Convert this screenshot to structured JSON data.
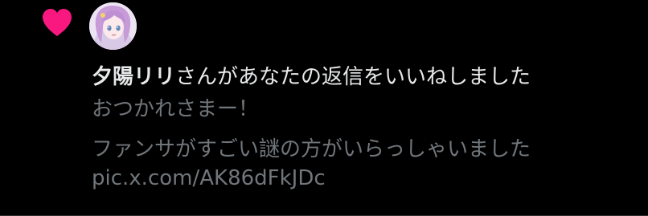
{
  "notification": {
    "icon": "heart-icon",
    "icon_color": "#f91880",
    "avatar": "user-avatar",
    "user_name": "夕陽リリ",
    "action_text": "さんがあなたの返信をいいねしました",
    "reply_text": "おつかれさまー！",
    "body_text": "ファンサがすごい謎の方がいらっしゃいました",
    "link_text": "pic.x.com/AK86dFkJDc"
  },
  "colors": {
    "background": "#000000",
    "primary_text": "#e7e9ea",
    "secondary_text": "#71767b"
  }
}
